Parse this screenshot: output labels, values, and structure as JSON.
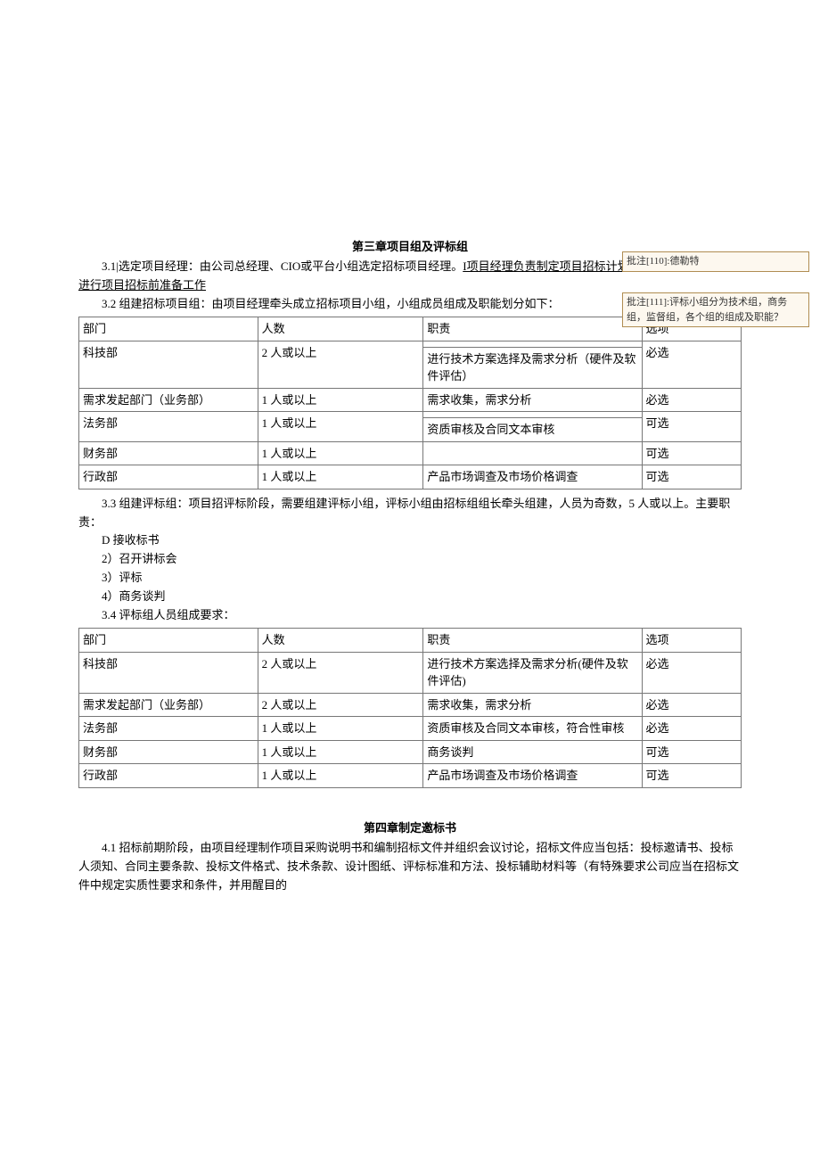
{
  "chapter3": {
    "heading": "第三章项目组及评标组",
    "p31_prefix": "3.1|选定项目经理：由公司总经理、CIO或平台小组选定招标项目经理。",
    "p31_underlined": "I项目经理负责制定项目招标计划书、组建项目团队、进行项目招标前准备工作",
    "p32": "3.2 组建招标项目组：由项目经理牵头成立招标项目小组，小组成员组成及职能划分如下：",
    "table1": {
      "headers": {
        "dept": "部门",
        "count": "人数",
        "resp": "职责",
        "opt": "选项"
      },
      "rows": [
        {
          "dept": "科技部",
          "count": "2 人或以上",
          "resp": "",
          "opt": "必选"
        },
        {
          "dept": "",
          "count": "",
          "resp": "进行技术方案选择及需求分析（硬件及软件评估）",
          "opt": ""
        },
        {
          "dept": "需求发起部门（业务部）",
          "count": "1 人或以上",
          "resp": "需求收集，需求分析",
          "opt": "必选"
        },
        {
          "dept": "法务部",
          "count": "1 人或以上",
          "resp": "",
          "opt": "可选"
        },
        {
          "dept": "",
          "count": "",
          "resp": "资质审核及合同文本审核",
          "opt": ""
        },
        {
          "dept": "财务部",
          "count": "1 人或以上",
          "resp": "",
          "opt": "可选"
        },
        {
          "dept": "行政部",
          "count": "1 人或以上",
          "resp": "产品市场调查及市场价格调查",
          "opt": "可选"
        }
      ]
    },
    "p33": "3.3 组建评标组：项目招评标阶段，需要组建评标小组，评标小组由招标组组长牵头组建，人员为奇数，5 人或以上。主要职责：",
    "list33": [
      "D 接收标书",
      "2）召开讲标会",
      "3）评标",
      "4）商务谈判"
    ],
    "p34": "3.4 评标组人员组成要求：",
    "table2": {
      "headers": {
        "dept": "部门",
        "count": "人数",
        "resp": "职责",
        "opt": "选项"
      },
      "rows": [
        {
          "dept": "科技部",
          "count": "2 人或以上",
          "resp": "进行技术方案选择及需求分析(硬件及软件评估)",
          "opt": "必选"
        },
        {
          "dept": "需求发起部门（业务部）",
          "count": "2 人或以上",
          "resp": "需求收集，需求分析",
          "opt": "必选"
        },
        {
          "dept": "法务部",
          "count": "1 人或以上",
          "resp": "资质审核及合同文本审核，符合性审核",
          "opt": "必选"
        },
        {
          "dept": "财务部",
          "count": "1 人或以上",
          "resp": "商务谈判",
          "opt": "可选"
        },
        {
          "dept": "行政部",
          "count": "1 人或以上",
          "resp": "产品市场调查及市场价格调查",
          "opt": "可选"
        }
      ]
    }
  },
  "chapter4": {
    "heading": "第四章制定邀标书",
    "p41": "4.1 招标前期阶段，由项目经理制作项目采购说明书和编制招标文件并组织会议讨论，招标文件应当包括：投标邀请书、投标人须知、合同主要条款、投标文件格式、技术条款、设计图纸、评标标准和方法、投标辅助材料等（有特殊要求公司应当在招标文件中规定实质性要求和条件，并用醒目的"
  },
  "comments": {
    "c1": {
      "label": "批注[110]:",
      "text": "德勒特"
    },
    "c2": {
      "label": "批注[111]:",
      "text": "评标小组分为技术组，商务组，监督组，各个组的组成及职能？"
    }
  }
}
